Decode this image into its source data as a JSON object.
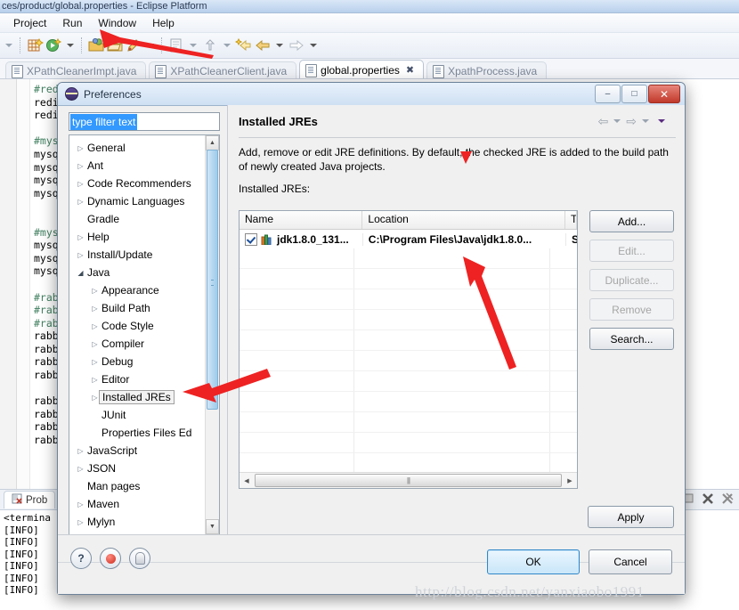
{
  "window": {
    "title": "ces/product/global.properties - Eclipse Platform",
    "menu": [
      "Project",
      "Run",
      "Window",
      "Help"
    ]
  },
  "editor_tabs": [
    {
      "label": "XPathCleanerImpt.java",
      "active": false,
      "closable": false
    },
    {
      "label": "XPathCleanerClient.java",
      "active": false,
      "closable": false
    },
    {
      "label": "global.properties",
      "active": true,
      "closable": true
    },
    {
      "label": "XpathProcess.java",
      "active": false,
      "closable": false
    }
  ],
  "editor_code": [
    {
      "t": "comment",
      "s": "#red"
    },
    {
      "t": "text",
      "s": "redi"
    },
    {
      "t": "text",
      "s": "redi"
    },
    {
      "t": "text",
      "s": ""
    },
    {
      "t": "comment",
      "s": "#mys"
    },
    {
      "t": "text",
      "s": "mysq"
    },
    {
      "t": "text",
      "s": "mysq"
    },
    {
      "t": "text",
      "s": "mysq"
    },
    {
      "t": "text",
      "s": "mysq"
    },
    {
      "t": "text",
      "s": ""
    },
    {
      "t": "text",
      "s": ""
    },
    {
      "t": "comment",
      "s": "#mys"
    },
    {
      "t": "text",
      "s": "mysq"
    },
    {
      "t": "text",
      "s": "mysq"
    },
    {
      "t": "text",
      "s": "mysq"
    },
    {
      "t": "text",
      "s": ""
    },
    {
      "t": "comment",
      "s": "#rab"
    },
    {
      "t": "comment",
      "s": "#rab"
    },
    {
      "t": "comment",
      "s": "#rab"
    },
    {
      "t": "text",
      "s": "rabb"
    },
    {
      "t": "text",
      "s": "rabb"
    },
    {
      "t": "text",
      "s": "rabb"
    },
    {
      "t": "text",
      "s": "rabb"
    },
    {
      "t": "text",
      "s": ""
    },
    {
      "t": "text",
      "s": "rabb"
    },
    {
      "t": "text",
      "s": "rabb"
    },
    {
      "t": "text",
      "s": "rabb"
    },
    {
      "t": "text",
      "s": "rabb"
    }
  ],
  "bottom_view": {
    "tab_label": "Prob",
    "console_lines": [
      "<termina",
      "[INFO]",
      "[INFO]",
      "[INFO]",
      "[INFO]",
      "[INFO]",
      "[INFO]"
    ]
  },
  "dialog": {
    "title": "Preferences",
    "window_buttons": {
      "minimize": "–",
      "maximize": "□",
      "close": "✕"
    },
    "filter": {
      "value": "type filter text",
      "placeholder": "type filter text"
    },
    "tree": [
      {
        "label": "General",
        "indent": 0,
        "arrow": "closed"
      },
      {
        "label": "Ant",
        "indent": 0,
        "arrow": "closed"
      },
      {
        "label": "Code Recommenders",
        "indent": 0,
        "arrow": "closed"
      },
      {
        "label": "Dynamic Languages",
        "indent": 0,
        "arrow": "closed"
      },
      {
        "label": "Gradle",
        "indent": 0,
        "arrow": "none"
      },
      {
        "label": "Help",
        "indent": 0,
        "arrow": "closed"
      },
      {
        "label": "Install/Update",
        "indent": 0,
        "arrow": "closed"
      },
      {
        "label": "Java",
        "indent": 0,
        "arrow": "open"
      },
      {
        "label": "Appearance",
        "indent": 1,
        "arrow": "closed"
      },
      {
        "label": "Build Path",
        "indent": 1,
        "arrow": "closed"
      },
      {
        "label": "Code Style",
        "indent": 1,
        "arrow": "closed"
      },
      {
        "label": "Compiler",
        "indent": 1,
        "arrow": "closed"
      },
      {
        "label": "Debug",
        "indent": 1,
        "arrow": "closed"
      },
      {
        "label": "Editor",
        "indent": 1,
        "arrow": "closed"
      },
      {
        "label": "Installed JREs",
        "indent": 1,
        "arrow": "closed",
        "selected": true
      },
      {
        "label": "JUnit",
        "indent": 1,
        "arrow": "none"
      },
      {
        "label": "Properties Files Ed",
        "indent": 1,
        "arrow": "none"
      },
      {
        "label": "JavaScript",
        "indent": 0,
        "arrow": "closed"
      },
      {
        "label": "JSON",
        "indent": 0,
        "arrow": "closed"
      },
      {
        "label": "Man pages",
        "indent": 0,
        "arrow": "none"
      },
      {
        "label": "Maven",
        "indent": 0,
        "arrow": "closed"
      },
      {
        "label": "Mylyn",
        "indent": 0,
        "arrow": "closed"
      }
    ],
    "page": {
      "title": "Installed JREs",
      "description": "Add, remove or edit JRE definitions. By default, the checked JRE is added to the build path of newly created Java projects.",
      "list_label": "Installed JREs:",
      "table": {
        "columns": [
          "Name",
          "Location",
          "Type"
        ],
        "rows": [
          {
            "checked": true,
            "name": "jdk1.8.0_131...",
            "location": "C:\\Program Files\\Java\\jdk1.8.0...",
            "type": "Stand"
          }
        ]
      },
      "side_buttons": [
        {
          "label": "Add...",
          "enabled": true
        },
        {
          "label": "Edit...",
          "enabled": false
        },
        {
          "label": "Duplicate...",
          "enabled": false
        },
        {
          "label": "Remove",
          "enabled": false
        },
        {
          "label": "Search...",
          "enabled": true
        }
      ]
    },
    "footer": {
      "help_icon": "?",
      "apply": "Apply",
      "ok": "OK",
      "cancel": "Cancel"
    }
  },
  "watermark": "http://blog.csdn.net/yanxiaobo1991",
  "colors": {
    "accent": "#3399ff",
    "comment_green": "#3f7f5f",
    "arrow_red": "#ee2222",
    "close_red": "#c0392b"
  }
}
